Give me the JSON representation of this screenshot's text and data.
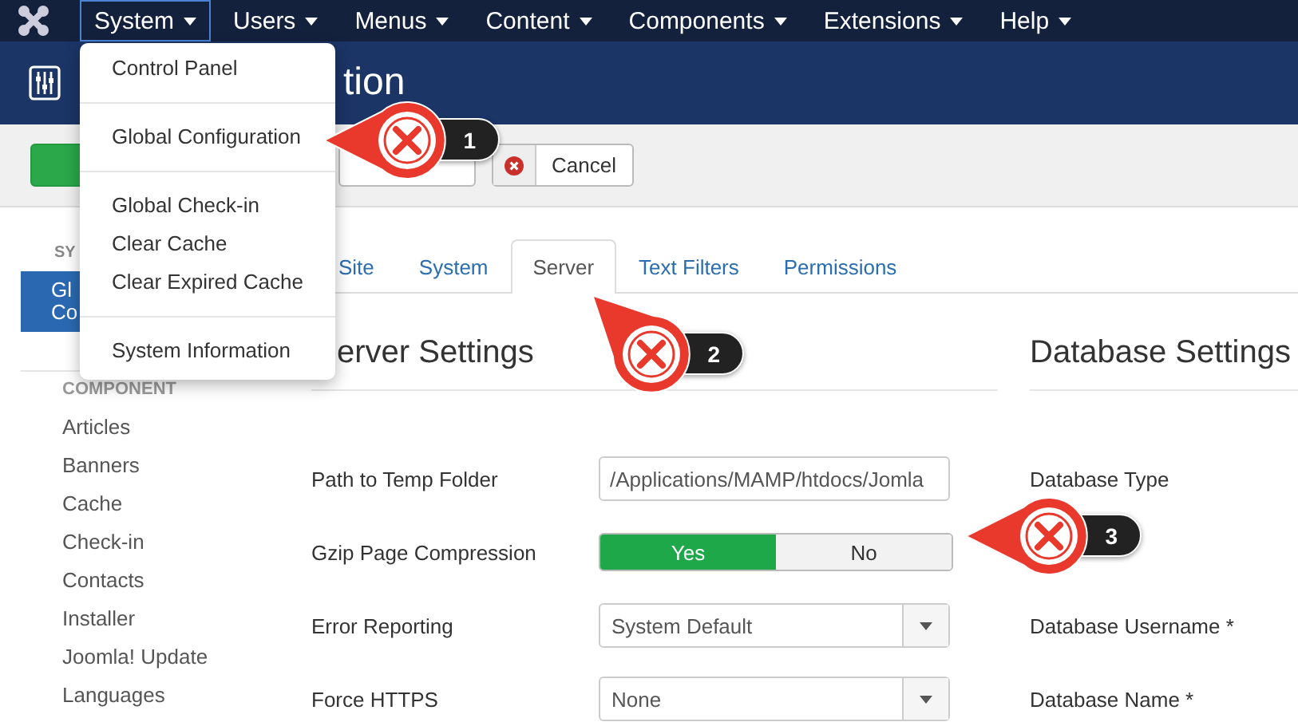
{
  "nav": {
    "items": [
      {
        "label": "System",
        "selected": true
      },
      {
        "label": "Users",
        "selected": false
      },
      {
        "label": "Menus",
        "selected": false
      },
      {
        "label": "Content",
        "selected": false
      },
      {
        "label": "Components",
        "selected": false
      },
      {
        "label": "Extensions",
        "selected": false
      },
      {
        "label": "Help",
        "selected": false
      }
    ]
  },
  "dropdown": {
    "groups": [
      [
        "Control Panel"
      ],
      [
        "Global Configuration"
      ],
      [
        "Global Check-in",
        "Clear Cache",
        "Clear Expired Cache"
      ],
      [
        "System Information"
      ]
    ]
  },
  "header": {
    "title": "tion"
  },
  "toolbar": {
    "buttons": [
      {
        "kind": "primary"
      },
      {
        "kind": "plain"
      },
      {
        "kind": "cancel",
        "label": "Cancel"
      }
    ]
  },
  "sidebar": {
    "sections": [
      {
        "heading": "SY",
        "items": [
          {
            "lines": [
              "Gl",
              "Co"
            ],
            "selected": true
          }
        ]
      },
      {
        "heading": "COMPONENT",
        "items": [
          {
            "lines": [
              "Articles"
            ],
            "selected": false
          },
          {
            "lines": [
              "Banners"
            ],
            "selected": false
          },
          {
            "lines": [
              "Cache"
            ],
            "selected": false
          },
          {
            "lines": [
              "Check-in"
            ],
            "selected": false
          },
          {
            "lines": [
              "Contacts"
            ],
            "selected": false
          },
          {
            "lines": [
              "Installer"
            ],
            "selected": false
          },
          {
            "lines": [
              "Joomla! Update"
            ],
            "selected": false
          },
          {
            "lines": [
              "Languages"
            ],
            "selected": false
          }
        ]
      }
    ]
  },
  "tabs": [
    {
      "label": "Site",
      "selected": false
    },
    {
      "label": "System",
      "selected": false
    },
    {
      "label": "Server",
      "selected": true
    },
    {
      "label": "Text Filters",
      "selected": false
    },
    {
      "label": "Permissions",
      "selected": false
    }
  ],
  "headings": {
    "server": "erver Settings",
    "database": "Database Settings"
  },
  "rows": [
    {
      "label": "Path to Temp Folder",
      "kind": "text",
      "value": "/Applications/MAMP/htdocs/Jomla",
      "database_label": "Database Type"
    },
    {
      "label": "Gzip Page Compression",
      "kind": "toggle",
      "options": [
        {
          "label": "Yes",
          "selected": true
        },
        {
          "label": "No",
          "selected": false
        }
      ]
    },
    {
      "label": "Error Reporting",
      "kind": "select",
      "value": "System Default",
      "database_label": "Database Username *"
    },
    {
      "label": "Force HTTPS",
      "kind": "select",
      "value": "None",
      "database_label": "Database Name *"
    }
  ],
  "callouts": [
    {
      "number": "1"
    },
    {
      "number": "2"
    },
    {
      "number": "3"
    }
  ]
}
